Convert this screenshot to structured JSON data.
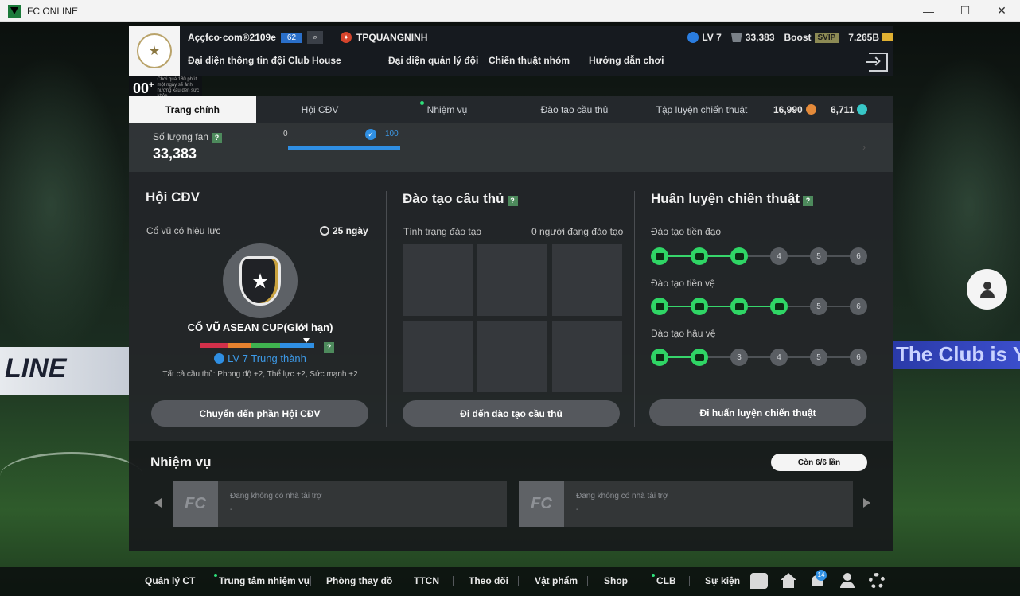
{
  "window": {
    "title": "FC ONLINE",
    "controls": [
      "—",
      "☐",
      "✕"
    ]
  },
  "header": {
    "username": "Aççfco·com®2109e",
    "level_badge": "62",
    "team_name": "TPQUANGNINH",
    "ovr": "00",
    "ovr_plus": "+",
    "ovr_note": "Chơi quá 180 phút một ngày sẽ ảnh hưởng xấu đến sức khỏe",
    "stats": {
      "level": "LV 7",
      "fans": "33,383",
      "boost_label": "Boost",
      "svip": "SVIP",
      "bp": "7.265B"
    },
    "nav": [
      "Đại diện thông tin đội",
      "Club House",
      "Đại diện quản lý đội",
      "Chiến thuật nhóm",
      "Hướng dẫn chơi"
    ]
  },
  "tabs": {
    "items": [
      "Trang chính",
      "Hội CĐV",
      "Nhiệm vụ",
      "Đào tạo cầu thủ",
      "Tập luyện chiến thuật"
    ],
    "active_index": 0,
    "currency_1": "16,990",
    "currency_2": "6,711"
  },
  "fans": {
    "label": "Số lượng fan",
    "value": "33,383",
    "bar_min": "0",
    "bar_max": "100",
    "progress": 1.0
  },
  "supporters": {
    "title": "Hội CĐV",
    "cheer_label": "Cổ vũ có hiệu lực",
    "days": "25 ngày",
    "cheer_name": "CỔ VŨ ASEAN CUP(Giới hạn)",
    "level_text": "LV 7 Trung thành",
    "effect_text": "Tất cả cầu thủ: Phong độ +2, Thể lực +2, Sức mạnh +2",
    "button": "Chuyển đến phần Hội CĐV"
  },
  "training": {
    "title": "Đào tạo cầu thủ",
    "status_label": "Tình trạng đào tạo",
    "status_value": "0 người đang đào tạo",
    "button": "Đi đến đào tạo cầu thủ"
  },
  "tactics": {
    "title": "Huấn luyện chiến thuật",
    "rows": [
      {
        "label": "Đào tạo tiền đạo",
        "completed": 3,
        "nodes": [
          "",
          "",
          "",
          "4",
          "5",
          "6"
        ]
      },
      {
        "label": "Đào tạo tiền vệ",
        "completed": 4,
        "nodes": [
          "",
          "",
          "",
          "",
          "5",
          "6"
        ]
      },
      {
        "label": "Đào tạo hậu vệ",
        "completed": 2,
        "nodes": [
          "",
          "",
          "3",
          "4",
          "5",
          "6"
        ]
      }
    ],
    "button": "Đi huấn luyện chiến thuật"
  },
  "missions": {
    "title": "Nhiệm vụ",
    "remaining": "Còn 6/6 lần",
    "sponsor_1": "Đang không có nhà tài trợ",
    "sponsor_2": "Đang không có nhà tài trợ",
    "dash": "-"
  },
  "bottom_nav": {
    "items": [
      "Quản lý CT",
      "Trung tâm nhiệm vụ",
      "Phòng thay đồ",
      "TTCN",
      "Theo dõi",
      "Vật phẩm",
      "Shop",
      "CLB",
      "Sự kiện"
    ],
    "notification_count": "14"
  },
  "background": {
    "ad_left": "LINE",
    "ad_right": "The Club is Y"
  },
  "colors": {
    "accent_blue": "#2f8fe3",
    "accent_green": "#2fd565",
    "panel_bg": "#242629"
  }
}
